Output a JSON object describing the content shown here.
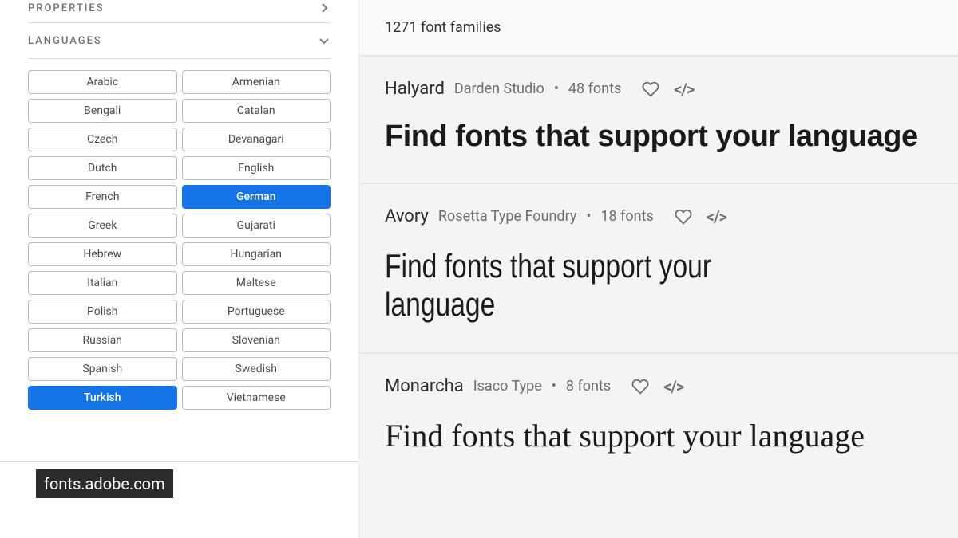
{
  "sidebar": {
    "sections": {
      "properties": {
        "label": "PROPERTIES"
      },
      "languages": {
        "label": "LANGUAGES"
      }
    },
    "languages": [
      {
        "label": "Arabic",
        "selected": false
      },
      {
        "label": "Armenian",
        "selected": false
      },
      {
        "label": "Bengali",
        "selected": false
      },
      {
        "label": "Catalan",
        "selected": false
      },
      {
        "label": "Czech",
        "selected": false
      },
      {
        "label": "Devanagari",
        "selected": false
      },
      {
        "label": "Dutch",
        "selected": false
      },
      {
        "label": "English",
        "selected": false
      },
      {
        "label": "French",
        "selected": false
      },
      {
        "label": "German",
        "selected": true
      },
      {
        "label": "Greek",
        "selected": false
      },
      {
        "label": "Gujarati",
        "selected": false
      },
      {
        "label": "Hebrew",
        "selected": false
      },
      {
        "label": "Hungarian",
        "selected": false
      },
      {
        "label": "Italian",
        "selected": false
      },
      {
        "label": "Maltese",
        "selected": false
      },
      {
        "label": "Polish",
        "selected": false
      },
      {
        "label": "Portuguese",
        "selected": false
      },
      {
        "label": "Russian",
        "selected": false
      },
      {
        "label": "Slovenian",
        "selected": false
      },
      {
        "label": "Spanish",
        "selected": false
      },
      {
        "label": "Swedish",
        "selected": false
      },
      {
        "label": "Turkish",
        "selected": true
      },
      {
        "label": "Vietnamese",
        "selected": false
      }
    ]
  },
  "badge": "fonts.adobe.com",
  "main": {
    "count_text": "1271 font families",
    "sample_text": "Find fonts that support your language",
    "fonts": [
      {
        "name": "Halyard",
        "foundry": "Darden Studio",
        "count": "48 fonts",
        "sample_class": "sample-halyard"
      },
      {
        "name": "Avory",
        "foundry": "Rosetta Type Foundry",
        "count": "18 fonts",
        "sample_class": "sample-avory"
      },
      {
        "name": "Monarcha",
        "foundry": "Isaco Type",
        "count": "8 fonts",
        "sample_class": "sample-monarcha"
      }
    ]
  }
}
